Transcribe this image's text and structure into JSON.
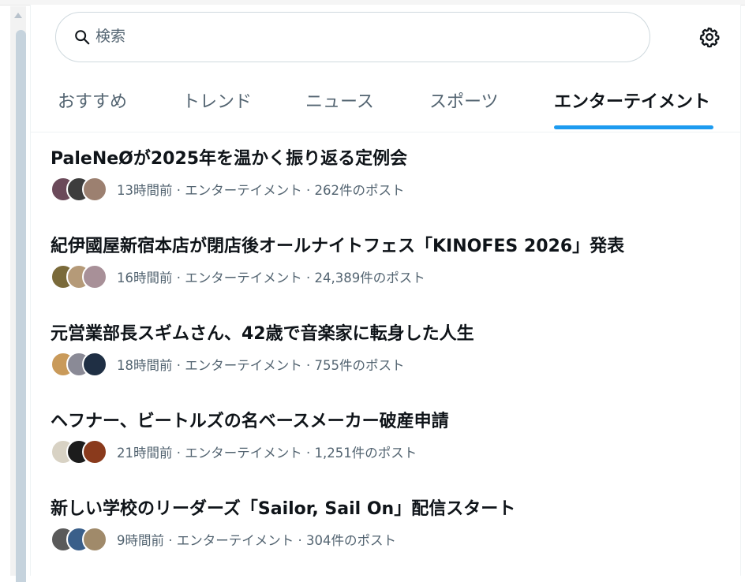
{
  "search": {
    "placeholder": "検索"
  },
  "settings": {
    "icon": "gear-icon"
  },
  "tabs": [
    {
      "label": "おすすめ",
      "active": false
    },
    {
      "label": "トレンド",
      "active": false
    },
    {
      "label": "ニュース",
      "active": false
    },
    {
      "label": "スポーツ",
      "active": false
    },
    {
      "label": "エンターテイメント",
      "active": true
    }
  ],
  "colors": {
    "accent": "#1d9bf0",
    "text": "#0f1419",
    "muted": "#536471",
    "border": "#cfd9de"
  },
  "trends": [
    {
      "title": "PaleNeØが2025年を温かく振り返る定例会",
      "meta": "13時間前 · エンターテイメント · 262件のポスト",
      "avatar_colors": [
        "#6b4a5a",
        "#3d3d3d",
        "#9c8070"
      ]
    },
    {
      "title": "紀伊國屋新宿本店が閉店後オールナイトフェス「KINOFES 2026」発表",
      "meta": "16時間前 · エンターテイメント · 24,389件のポスト",
      "avatar_colors": [
        "#7a6a3a",
        "#b59a78",
        "#a89098"
      ]
    },
    {
      "title": "元営業部長スギムさん、42歳で音楽家に転身した人生",
      "meta": "18時間前 · エンターテイメント · 755件のポスト",
      "avatar_colors": [
        "#c99a5a",
        "#8a8a96",
        "#1f2f44"
      ]
    },
    {
      "title": "ヘフナー、ビートルズの名ベースメーカー破産申請",
      "meta": "21時間前 · エンターテイメント · 1,251件のポスト",
      "avatar_colors": [
        "#d8d2c4",
        "#1c1c1c",
        "#8a3a1c"
      ]
    },
    {
      "title": "新しい学校のリーダーズ「Sailor, Sail On」配信スタート",
      "meta": "9時間前 · エンターテイメント · 304件のポスト",
      "avatar_colors": [
        "#5a5a5a",
        "#3a5f8a",
        "#a08a6a"
      ]
    }
  ]
}
